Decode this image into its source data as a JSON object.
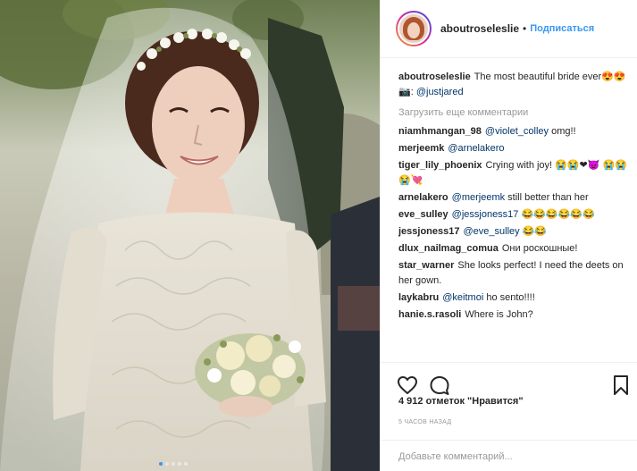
{
  "header": {
    "username": "aboutroseleslie",
    "separator": "•",
    "follow_label": "Подписаться"
  },
  "caption": {
    "username": "aboutroseleslie",
    "text": "The most beautiful bride ever😍😍",
    "credit_icon": "📷",
    "credit_mention": "@justjared"
  },
  "load_more_label": "Загрузить еще комментарии",
  "comments": [
    {
      "user": "niamhmangan_98",
      "mention": "@violet_colley",
      "text": " omg!!"
    },
    {
      "user": "merjeemk",
      "mention": "@arnelakero",
      "text": ""
    },
    {
      "user": "tiger_lily_phoenix",
      "mention": "",
      "text": "Crying with joy! 😭😭❤👿 😭😭😭💘"
    },
    {
      "user": "arnelakero",
      "mention": "@merjeemk",
      "text": " still better than her"
    },
    {
      "user": "eve_sulley",
      "mention": "@jessjoness17",
      "text": " 😂😂😂😂😂😂"
    },
    {
      "user": "jessjoness17",
      "mention": "@eve_sulley",
      "text": " 😂😂"
    },
    {
      "user": "dlux_nailmag_comua",
      "mention": "",
      "text": "Они роскошные!"
    },
    {
      "user": "star_warner",
      "mention": "",
      "text": "She looks perfect! I need the deets on her gown."
    },
    {
      "user": "laykabru",
      "mention": "@keitmoi",
      "text": " ho sento!!!!"
    },
    {
      "user": "hanie.s.rasoli",
      "mention": "",
      "text": "Where is John?"
    }
  ],
  "actions": {
    "like_icon": "heart-icon",
    "comment_icon": "speech-bubble-icon",
    "save_icon": "bookmark-icon"
  },
  "likes_text": "4 912 отметок \"Нравится\"",
  "timestamp": "5 часов назад",
  "add_comment": {
    "placeholder": "Добавьте комментарий..."
  },
  "carousel": {
    "count": 5,
    "active_index": 0
  },
  "colors": {
    "link": "#003569",
    "follow": "#3897f0",
    "muted": "#999999",
    "text": "#262626"
  }
}
